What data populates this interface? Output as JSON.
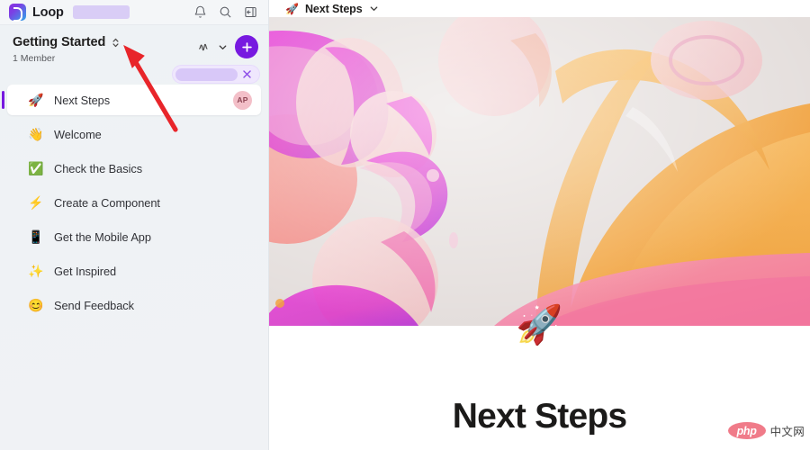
{
  "app": {
    "name": "Loop",
    "logo_icon": "loop-logo-icon",
    "redacted_label": ""
  },
  "topbar": {
    "icons": [
      {
        "name": "notifications-bell-icon",
        "label": "Notifications"
      },
      {
        "name": "search-icon",
        "label": "Search"
      },
      {
        "name": "collapse-panel-icon",
        "label": "Collapse side panel"
      }
    ]
  },
  "workspace": {
    "title": "Getting Started",
    "expand_icon": "chevron-up-down-icon",
    "member_count": "1 Member",
    "activity_icon": "activity-squiggle-icon",
    "activity_chevron": "chevron-down-icon",
    "add_label": "+",
    "redacted_pill": {
      "value": "",
      "close_icon": "close-x-icon"
    }
  },
  "pages": [
    {
      "emoji": "🚀",
      "icon_name": "rocket-icon",
      "label": "Next Steps",
      "selected": true,
      "avatar": "AP"
    },
    {
      "emoji": "👋",
      "icon_name": "waving-hand-icon",
      "label": "Welcome",
      "selected": false,
      "avatar": ""
    },
    {
      "emoji": "✅",
      "icon_name": "check-mark-box-icon",
      "label": "Check the Basics",
      "selected": false,
      "avatar": ""
    },
    {
      "emoji": "⚡",
      "icon_name": "lightning-bolt-icon",
      "label": "Create a Component",
      "selected": false,
      "avatar": ""
    },
    {
      "emoji": "📱",
      "icon_name": "mobile-phone-icon",
      "label": "Get the Mobile App",
      "selected": false,
      "avatar": ""
    },
    {
      "emoji": "✨",
      "icon_name": "sparkles-icon",
      "label": "Get Inspired",
      "selected": false,
      "avatar": ""
    },
    {
      "emoji": "😊",
      "icon_name": "smiling-face-icon",
      "label": "Send Feedback",
      "selected": false,
      "avatar": ""
    }
  ],
  "main": {
    "breadcrumb_emoji": "🚀",
    "breadcrumb_title": "Next Steps",
    "breadcrumb_chevron": "chevron-down-icon",
    "cover_alt": "abstract-glass-bubbles-cover",
    "doc_emoji": "🚀",
    "doc_title": "Next Steps"
  },
  "annotation": {
    "arrow_color": "#E8252A",
    "arrow_name": "red-pointer-arrow"
  },
  "watermark": {
    "badge": "php",
    "text": "中文网"
  },
  "colors": {
    "accent_purple": "#7719E0",
    "sidebar_bg": "#eff2f5",
    "selected_bg": "#ffffff",
    "avatar_bg": "#f3bfc8",
    "watermark_badge": "#f07b89"
  }
}
